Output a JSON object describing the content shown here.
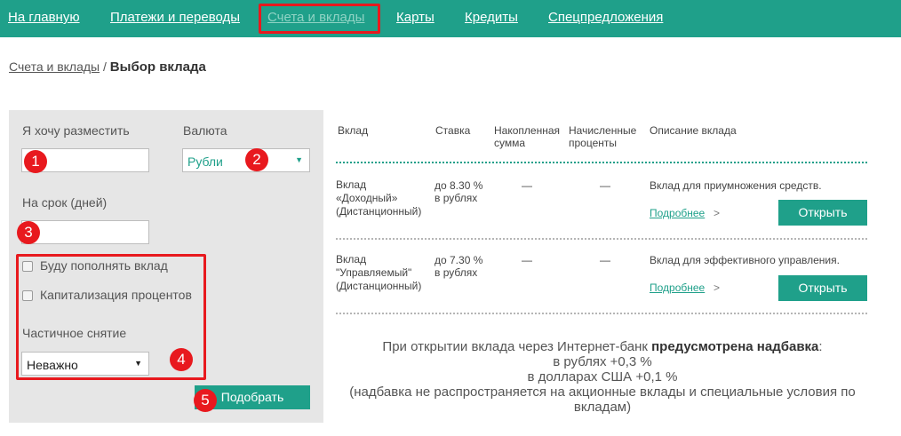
{
  "nav": {
    "home": "На главную",
    "payments": "Платежи и переводы",
    "accounts": "Счета и вклады",
    "cards": "Карты",
    "credits": "Кредиты",
    "offers": "Спецпредложения"
  },
  "breadcrumb": {
    "parent": "Счета и вклады",
    "separator": "/",
    "current": "Выбор вклада"
  },
  "filter": {
    "amount_label": "Я хочу разместить",
    "currency_label": "Валюта",
    "currency_value": "Рубли",
    "term_label": "На срок (дней)",
    "replenish_label": "Буду пополнять вклад",
    "capitalization_label": "Капитализация процентов",
    "withdraw_label": "Частичное снятие",
    "withdraw_value": "Неважно",
    "submit_label": "Подобрать"
  },
  "badges": [
    "1",
    "2",
    "3",
    "4",
    "5"
  ],
  "table": {
    "headers": [
      "Вклад",
      "Ставка",
      "Накопленная\nсумма",
      "Начисленные\nпроценты",
      "Описание вклада"
    ],
    "rows": [
      {
        "name": "Вклад\n«Доходный»\n(Дистанционный)",
        "rate": "до 8.30 %\nв рублях",
        "accumulated": "—",
        "interest": "—",
        "description": "Вклад для приумножения средств.",
        "more": "Подробнее",
        "more_arrow": ">",
        "open": "Открыть"
      },
      {
        "name": "Вклад\n\"Управляемый\"\n(Дистанционный)",
        "rate": "до 7.30 %\nв рублях",
        "accumulated": "—",
        "interest": "—",
        "description": "Вклад для эффективного управления.",
        "more": "Подробнее",
        "more_arrow": ">",
        "open": "Открыть"
      }
    ]
  },
  "notice": {
    "text_before": "При открытии вклада через Интернет-банк",
    "text_bold": "предусмотрена надбавка",
    "text_colon": ":",
    "line_rub": "в рублях +0,3 %",
    "line_usd": "в долларах США +0,1 %",
    "line_note": "(надбавка не распространяется на акционные вклады и специальные условия по вкладам)"
  },
  "colors": {
    "brand": "#1fa08a",
    "highlight": "#e8191e",
    "panel": "#e6e6e6"
  }
}
